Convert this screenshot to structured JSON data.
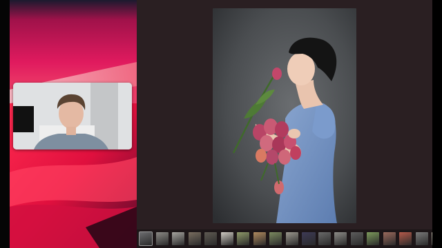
{
  "wallpaper": {
    "colors": {
      "base": "#e0154f",
      "dark": "#1a0b12",
      "light": "#f4a7b7"
    }
  },
  "webcam": {
    "subject": "person-portrait",
    "background": "#d7d9db"
  },
  "viewer": {
    "background": "#2a1f22",
    "photo": {
      "subject": "woman-with-tulips",
      "backdrop": "#4e5154",
      "dress": "#6f8fbf"
    },
    "filmstrip": {
      "selected_index": 0,
      "thumbnails": [
        {
          "tone": "#6d6d70"
        },
        {
          "tone": "#8c8a86"
        },
        {
          "tone": "#a7a5a0"
        },
        {
          "tone": "#7a6e60"
        },
        {
          "tone": "#5f5a52"
        },
        {
          "tone": "#cfcac2"
        },
        {
          "tone": "#8f9a6a"
        },
        {
          "tone": "#b08a5e"
        },
        {
          "tone": "#7c8a60"
        },
        {
          "tone": "#9c988f"
        },
        {
          "tone": "#3d3a55"
        },
        {
          "tone": "#6a6a6a"
        },
        {
          "tone": "#8d8c88"
        },
        {
          "tone": "#5d5d5d"
        },
        {
          "tone": "#7d9a5c"
        },
        {
          "tone": "#9a6a5c"
        },
        {
          "tone": "#b55a4a"
        },
        {
          "tone": "#7a7a7a"
        },
        {
          "tone": "#cfc8b8"
        }
      ]
    }
  }
}
